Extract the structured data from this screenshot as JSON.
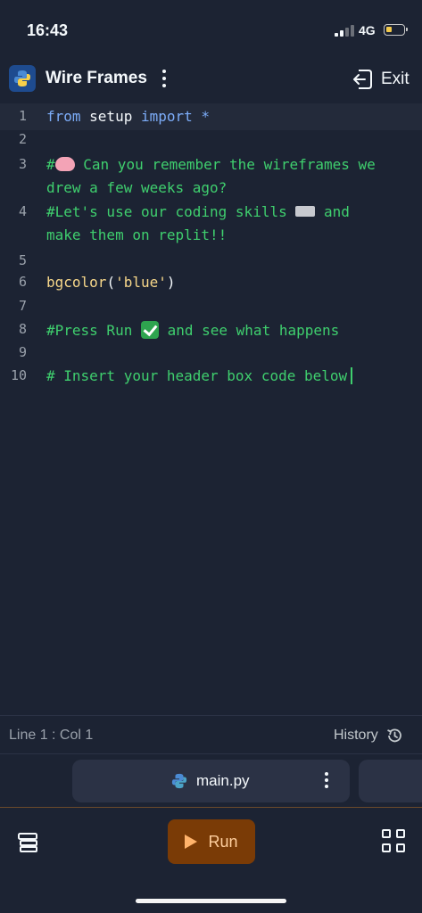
{
  "status_bar": {
    "time": "16:43",
    "network": "4G"
  },
  "header": {
    "title": "Wire Frames",
    "logo_icon": "python-logo-icon",
    "exit_label": "Exit"
  },
  "editor": {
    "lines": [
      {
        "num": "1",
        "t1": "from",
        "t2": " setup ",
        "t3": "import",
        "t4": " *"
      },
      {
        "num": "2"
      },
      {
        "num": "3",
        "text_a": "#",
        "text_b": " Can you remember the wireframes we",
        "cont": "drew a few weeks ago?"
      },
      {
        "num": "4",
        "text_a": "#Let's use our coding skills ",
        "text_b": " and",
        "cont": "make them on replit!!"
      },
      {
        "num": "5"
      },
      {
        "num": "6",
        "fn": "bgcolor",
        "p1": "(",
        "str": "'blue'",
        "p2": ")"
      },
      {
        "num": "7"
      },
      {
        "num": "8",
        "text_a": "#Press Run ",
        "text_b": " and see what happens"
      },
      {
        "num": "9"
      },
      {
        "num": "10",
        "text": "# Insert your header box code below"
      }
    ],
    "emoji_names": [
      "brain-emoji",
      "keyboard-emoji",
      "check-mark-emoji"
    ]
  },
  "status_line": {
    "position": "Line 1 : Col 1",
    "history_label": "History"
  },
  "tabs": {
    "active_file": "main.py"
  },
  "bottom": {
    "run_label": "Run"
  },
  "colors": {
    "background": "#1c2333",
    "comment": "#3fcf6e",
    "keyword": "#7cacf8",
    "run_button": "#7a3b06"
  }
}
